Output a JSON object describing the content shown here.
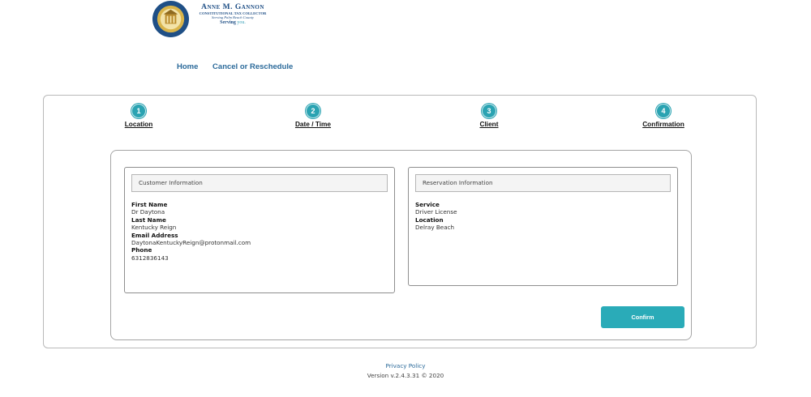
{
  "logo": {
    "name": "Anne M. Gannon",
    "line1": "CONSTITUTIONAL TAX COLLECTOR",
    "line2": "Serving Palm Beach County",
    "serving": "Serving",
    "you": "you."
  },
  "nav": {
    "home": "Home",
    "cancel": "Cancel or Reschedule"
  },
  "steps": [
    {
      "number": "1",
      "label": "Location"
    },
    {
      "number": "2",
      "label": "Date / Time"
    },
    {
      "number": "3",
      "label": "Client"
    },
    {
      "number": "4",
      "label": "Confirmation"
    }
  ],
  "customer": {
    "header": "Customer Information",
    "first_name_label": "First Name",
    "first_name": "Dr Daytona",
    "last_name_label": "Last Name",
    "last_name": "Kentucky Reign",
    "email_label": "Email Address",
    "email": "DaytonaKentuckyReign@protonmail.com",
    "phone_label": "Phone",
    "phone": "6312836143"
  },
  "reservation": {
    "header": "Reservation Information",
    "service_label": "Service",
    "service": "Driver License",
    "location_label": "Location",
    "location": "Delray Beach"
  },
  "confirm_label": "Confirm",
  "footer": {
    "privacy": "Privacy Policy",
    "version": "Version v.2.4.3.31 © 2020"
  },
  "colors": {
    "accent": "#2aabb8",
    "link": "#2b6a9a"
  }
}
